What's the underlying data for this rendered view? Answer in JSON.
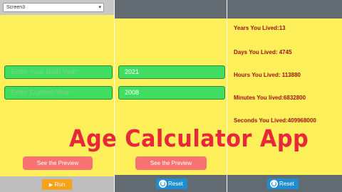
{
  "panel1": {
    "screen_select": "Screen3",
    "birth_year_placeholder": "Enter Your Birth Year",
    "current_year_placeholder": "Enter Current Year",
    "preview_label": "See the Preview",
    "run_label": "Run"
  },
  "panel2": {
    "current_year_value": "2021",
    "birth_year_value": "2008",
    "preview_label": "See the Preview",
    "reset_label": "Reset"
  },
  "panel3": {
    "years": "Years You Lived:13",
    "days": "Days You Lived:  4745",
    "hours": "Hours You Lived:  113880",
    "minutes": "Minutes You lived:6832800",
    "seconds": "Seconds You Lived:409968000",
    "reset_label": "Reset"
  },
  "title": "Age Calculator App",
  "colors": {
    "background": "#fdf05a",
    "field": "#40dd60",
    "button": "#f87272",
    "title": "#e8283a",
    "result_text": "#9e0f12"
  }
}
